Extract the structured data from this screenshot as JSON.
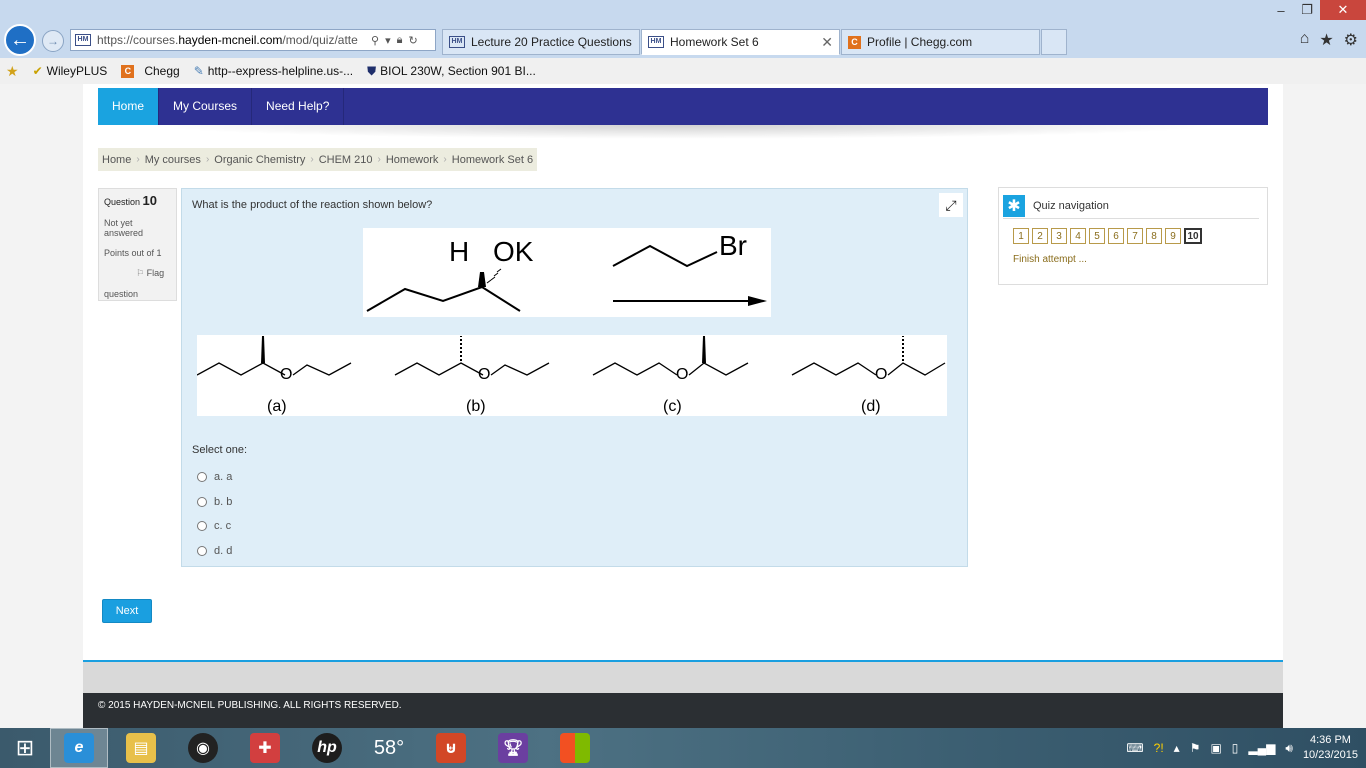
{
  "browser": {
    "address": {
      "prefix": "https://courses.",
      "domain": "hayden-mcneil.com",
      "path": "/mod/quiz/atte"
    },
    "tabs": [
      {
        "label": "Lecture 20 Practice Questions"
      },
      {
        "label": "Homework Set 6"
      },
      {
        "label": "Profile | Chegg.com"
      }
    ],
    "favorites": [
      "WileyPLUS",
      "Chegg",
      "http--express-helpline.us-...",
      "BIOL 230W, Section 901 BI..."
    ]
  },
  "nav": {
    "items": [
      "Home",
      "My Courses",
      "Need Help?"
    ]
  },
  "breadcrumb": [
    "Home",
    "My courses",
    "Organic Chemistry",
    "CHEM 210",
    "Homework",
    "Homework Set 6"
  ],
  "question_info": {
    "label": "Question",
    "number": "10",
    "status": "Not yet answered",
    "points": "Points out of 1",
    "flag_line1": "Flag",
    "flag_line2": "question"
  },
  "question": {
    "text": "What is the product of the reaction shown below?",
    "reactant_h": "H",
    "reactant_ok": "OK",
    "reagent": "Br",
    "option_labels": [
      "(a)",
      "(b)",
      "(c)",
      "(d)"
    ],
    "oxygen": "O",
    "select_label": "Select one:",
    "answers": [
      "a. a",
      "b. b",
      "c. c",
      "d. d"
    ]
  },
  "quiz_nav": {
    "title": "Quiz navigation",
    "questions": [
      "1",
      "2",
      "3",
      "4",
      "5",
      "6",
      "7",
      "8",
      "9",
      "10"
    ],
    "current": "10",
    "finish": "Finish attempt ..."
  },
  "next_label": "Next",
  "footer": "© 2015 HAYDEN-MCNEIL PUBLISHING. ALL RIGHTS RESERVED.",
  "taskbar": {
    "weather": "58°",
    "time": "4:36 PM",
    "date": "10/23/2015"
  }
}
